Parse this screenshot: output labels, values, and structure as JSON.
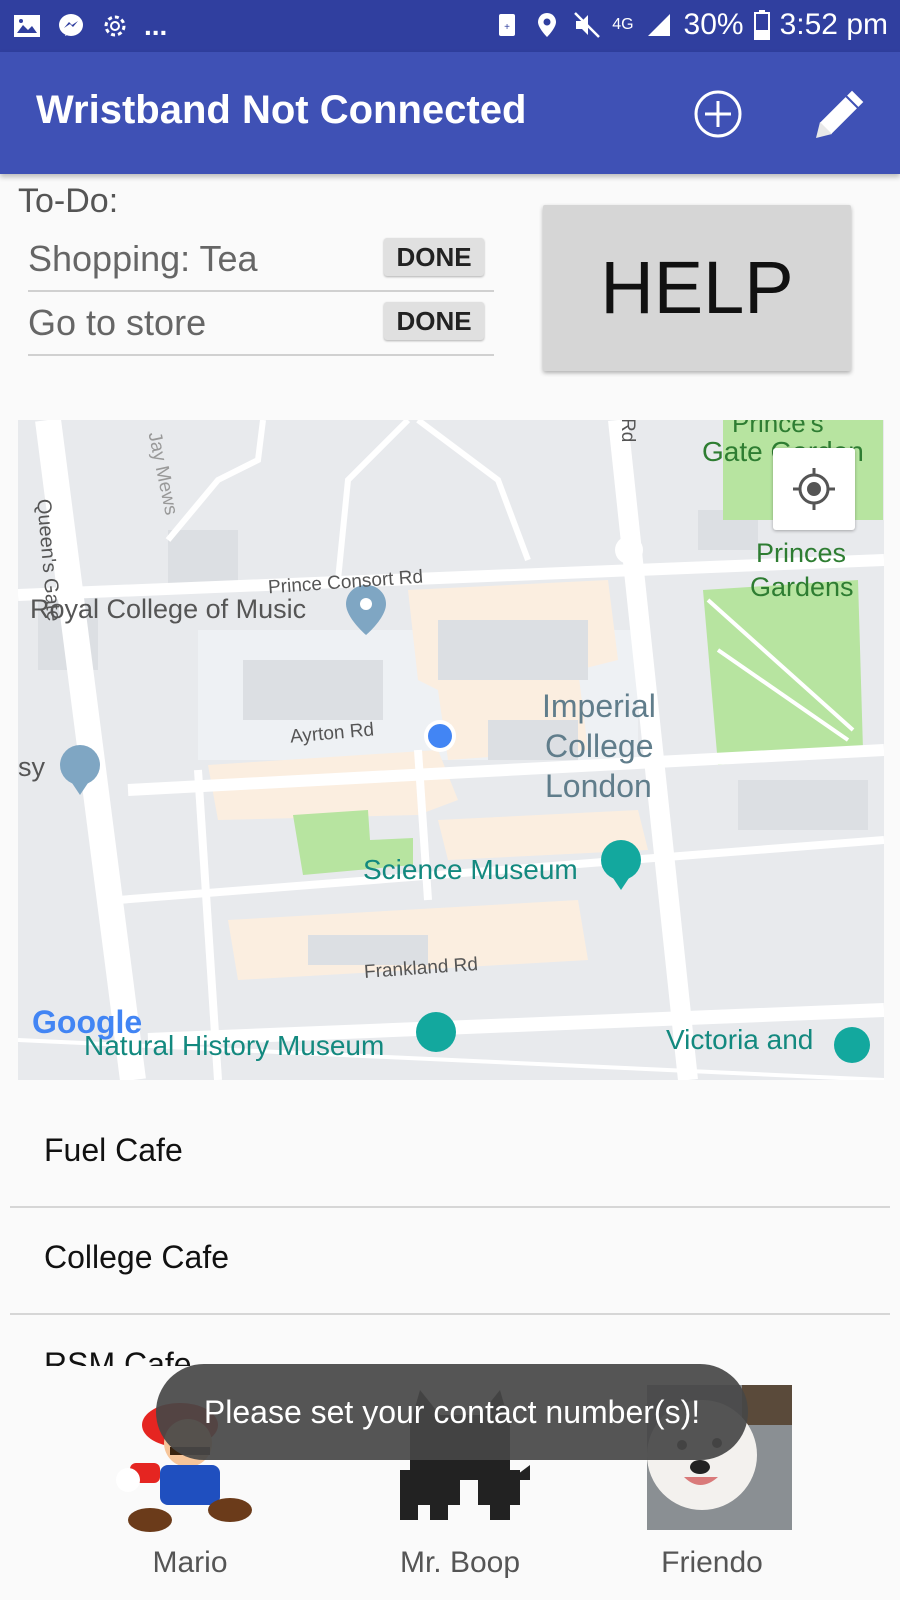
{
  "status_bar": {
    "more": "...",
    "network": "4G",
    "battery": "30%",
    "time": "3:52 pm"
  },
  "app_bar": {
    "title": "Wristband Not Connected",
    "icons": [
      "add-circle-icon",
      "pencil-icon"
    ]
  },
  "todo": {
    "title": "To-Do:",
    "items": [
      {
        "text": "Shopping: Tea",
        "button": "DONE"
      },
      {
        "text": "Go to store",
        "button": "DONE"
      }
    ]
  },
  "help_button": "HELP",
  "map": {
    "labels": {
      "queens_gate": "Queen's Gate",
      "jay_mews": "Jay Mews",
      "rd_top": "Rd",
      "princes_gate_garden_1": "Prince's",
      "princes_gate_garden_2": "Gate Garden",
      "princes_gardens_1": "Princes",
      "princes_gardens_2": "Gardens",
      "prince_consort_rd": "Prince Consort Rd",
      "royal_college": "Royal College of Music",
      "imperial_1": "Imperial",
      "imperial_2": "College",
      "imperial_3": "London",
      "ayrton_rd": "Ayrton Rd",
      "sy": "sy",
      "science_museum": "Science Museum",
      "frankland_rd": "Frankland Rd",
      "natural_history": "Natural History Museum",
      "victoria": "Victoria and",
      "google": "Google"
    }
  },
  "places": [
    "Fuel Cafe",
    "College Cafe",
    "RSM Cafe"
  ],
  "contacts": [
    {
      "name": "Mario"
    },
    {
      "name": "Mr. Boop"
    },
    {
      "name": "Friendo"
    }
  ],
  "toast": "Please set your contact number(s)!"
}
